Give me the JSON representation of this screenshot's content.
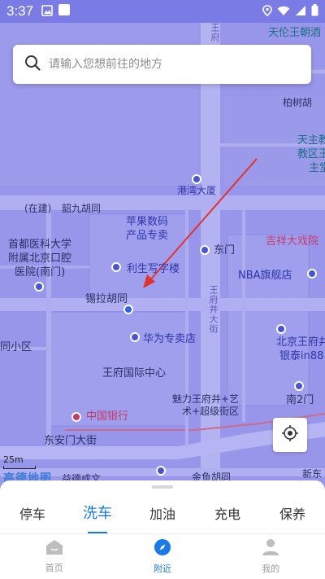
{
  "status_bar": {
    "time": "3:37"
  },
  "search": {
    "placeholder": "请输入您想前往的地方"
  },
  "map": {
    "labels": {
      "tianlun": "天伦王朝酒",
      "wangfu_v": "王府",
      "baishu": "柏树胡",
      "church1": "天主教",
      "church2": "教区王",
      "church3": "主堂",
      "gangwan": "港湾大厦",
      "zaijian": "(在建)",
      "shaojiu": "韶九胡同",
      "apple1": "苹果数码",
      "apple2": "产品专卖",
      "lisheng": "利生写字楼",
      "dongmen": "东门",
      "jixiang": "吉祥大戏院",
      "shouyi1": "首都医科大学",
      "shouyi2": "附属北京口腔",
      "shouyi3": "医院(南门)",
      "nba": "NBA旗舰店",
      "xila": "锡拉胡同",
      "huawei": "华为专卖店",
      "tongxiao": "同小区",
      "bjwangfu1": "北京王府井",
      "bjwangfu2": "银泰in88",
      "wfjcenter": "王府国际中心",
      "south2": "南2门",
      "meili1": "魅力王府井+艺",
      "meili2": "术+超级街区",
      "boc": "中国银行",
      "jinyu": "金鱼",
      "dongan": "东安门大街",
      "jinyuhu": "金鱼胡同",
      "yuyi": "益德成文",
      "xindong": "新东",
      "road_v2": "王府井大街"
    }
  },
  "scale": {
    "label": "25m"
  },
  "logo": {
    "text": "高德地图"
  },
  "service_tabs": [
    {
      "label": "停车",
      "active": false
    },
    {
      "label": "洗车",
      "active": true
    },
    {
      "label": "加油",
      "active": false
    },
    {
      "label": "充电",
      "active": false
    },
    {
      "label": "保养",
      "active": false
    }
  ],
  "bottom_nav": [
    {
      "label": "首页",
      "icon": "home-icon",
      "active": false
    },
    {
      "label": "附近",
      "icon": "compass-icon",
      "active": true
    },
    {
      "label": "我的",
      "icon": "person-icon",
      "active": false
    }
  ],
  "colors": {
    "accent": "#1a7ae8",
    "map_overlay": "#8f8ee8",
    "arrow": "#e0332f"
  }
}
